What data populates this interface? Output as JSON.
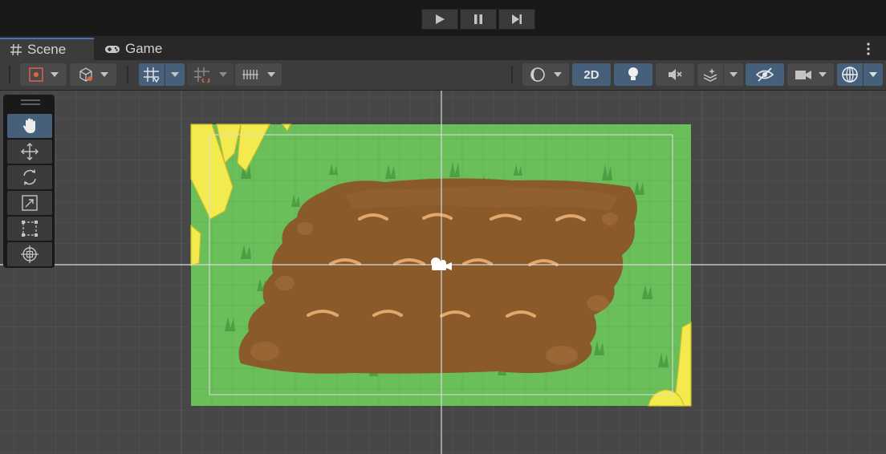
{
  "playbar": {
    "buttons": [
      {
        "name": "play-button",
        "icon": "play-icon"
      },
      {
        "name": "pause-button",
        "icon": "pause-icon"
      },
      {
        "name": "step-button",
        "icon": "step-forward-icon"
      }
    ]
  },
  "tabs": [
    {
      "label": "Scene",
      "icon": "grid-hash-icon",
      "active": true
    },
    {
      "label": "Game",
      "icon": "gamepad-icon",
      "active": false
    }
  ],
  "toolbar": {
    "mode_2d_label": "2D",
    "icons": [
      "transform-tool-icon",
      "draw-mode-icon",
      "grid-snap-icon",
      "increment-snap-icon",
      "ruler-icon",
      "shading-sphere-icon",
      "lighting-icon",
      "mute-audio-icon",
      "effects-icon",
      "scene-visibility-icon",
      "camera-icon",
      "gizmos-icon",
      "more-menu-icon"
    ]
  },
  "tools": [
    "hand-tool-icon",
    "move-tool-icon",
    "rotate-tool-icon",
    "scale-tool-icon",
    "rect-tool-icon",
    "transform-tool-icon"
  ],
  "colors": {
    "accent": "#46607c",
    "grass": "#6bbf5b",
    "dirt": "#8b5a2b",
    "fence": "#f4f060"
  }
}
